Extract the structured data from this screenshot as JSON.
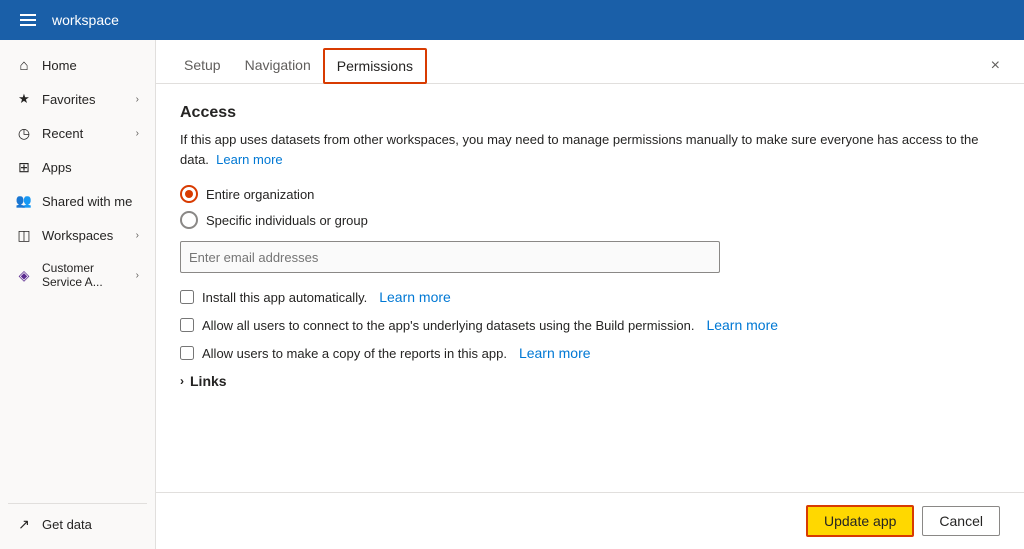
{
  "header": {
    "title": "workspace",
    "close_label": "×"
  },
  "sidebar": {
    "items": [
      {
        "id": "home",
        "label": "Home",
        "icon": "home",
        "has_chevron": false
      },
      {
        "id": "favorites",
        "label": "Favorites",
        "icon": "favorites",
        "has_chevron": true
      },
      {
        "id": "recent",
        "label": "Recent",
        "icon": "recent",
        "has_chevron": true
      },
      {
        "id": "apps",
        "label": "Apps",
        "icon": "apps",
        "has_chevron": false
      },
      {
        "id": "shared",
        "label": "Shared with me",
        "icon": "shared",
        "has_chevron": false
      },
      {
        "id": "workspaces",
        "label": "Workspaces",
        "icon": "workspaces",
        "has_chevron": true
      },
      {
        "id": "customer",
        "label": "Customer Service A...",
        "icon": "customer",
        "has_chevron": true
      }
    ],
    "bottom_items": [
      {
        "id": "getdata",
        "label": "Get data",
        "icon": "getdata",
        "has_chevron": false
      }
    ]
  },
  "tabs": {
    "items": [
      {
        "id": "setup",
        "label": "Setup",
        "active": false
      },
      {
        "id": "navigation",
        "label": "Navigation",
        "active": false
      },
      {
        "id": "permissions",
        "label": "Permissions",
        "active": true
      }
    ]
  },
  "panel": {
    "access_title": "Access",
    "info_text": "If this app uses datasets from other workspaces, you may need to manage permissions manually to make sure everyone has access to the data.",
    "learn_more_1": "Learn more",
    "radio_entire_org": "Entire organization",
    "radio_specific": "Specific individuals or group",
    "email_placeholder": "Enter email addresses",
    "checkbox1_label": "Install this app automatically.",
    "checkbox1_learn_more": "Learn more",
    "checkbox2_label": "Allow all users to connect to the app's underlying datasets using the Build permission.",
    "checkbox2_learn_more": "Learn more",
    "checkbox3_label": "Allow users to make a copy of the reports in this app.",
    "checkbox3_learn_more": "Learn more",
    "links_section_label": "Links"
  },
  "footer": {
    "update_label": "Update app",
    "cancel_label": "Cancel"
  }
}
